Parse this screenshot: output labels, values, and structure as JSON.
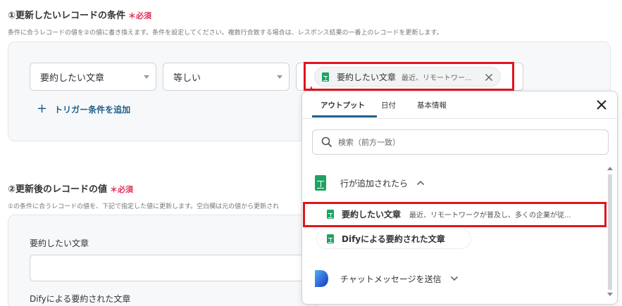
{
  "section1": {
    "title": "①更新したいレコードの条件",
    "required": "＊必須",
    "description": "条件に合うレコードの値を②の値に書き換えます。条件を設定してください。複数行合致する場合は、レスポンス結果の一番上のレコードを更新します。",
    "field_select": "要約したい文章",
    "operator_select": "等しい",
    "value_chip": {
      "label": "要約したい文章",
      "preview": "最近、リモートワー..."
    },
    "add_condition": "トリガー条件を追加"
  },
  "section2": {
    "title": "②更新後のレコードの値",
    "required": "＊必須",
    "description": "①の条件に合うレコードの値を、下記で指定した値に更新します。空白欄は元の値から更新され",
    "field1_label": "要約したい文章",
    "field2_label": "Difyによる要約された文章"
  },
  "popup": {
    "tabs": [
      "アウトプット",
      "日付",
      "基本情報"
    ],
    "active_tab": "アウトプット",
    "search_placeholder": "検索（前方一致）",
    "group1": {
      "label": "行が追加されたら",
      "expanded": true
    },
    "items": [
      {
        "label": "要約したい文章",
        "preview": "最近、リモートワークが普及し、多くの企業が従..."
      },
      {
        "label": "Difyによる要約された文章",
        "preview": ""
      }
    ],
    "group2": {
      "label": "チャットメッセージを送信",
      "expanded": false
    }
  },
  "colors": {
    "accent": "#1f5f8b",
    "required": "#e0305a",
    "highlight": "#e0151d",
    "sheets_green": "#1ea362"
  }
}
